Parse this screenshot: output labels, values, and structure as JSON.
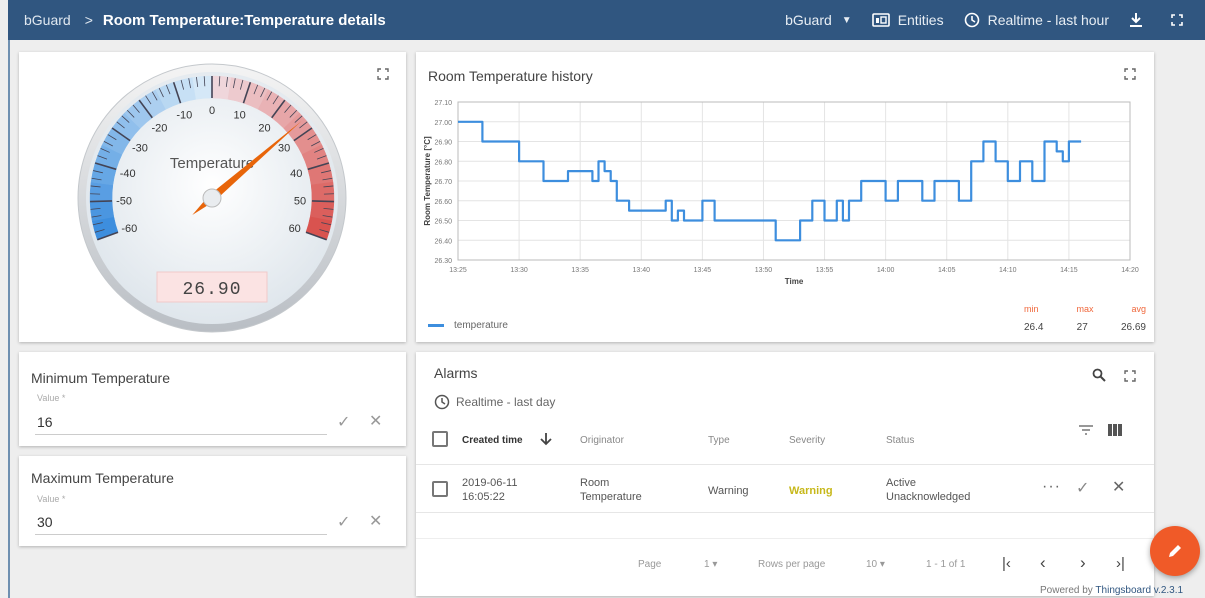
{
  "topbar": {
    "root": "bGuard",
    "separator": ">",
    "title": "Room Temperature:Temperature details",
    "entity_select": "bGuard",
    "entities_label": "Entities",
    "timewindow_label": "Realtime - last hour"
  },
  "gauge": {
    "label": "Temperature",
    "value_display": "26.90",
    "value": 26.9,
    "min": -60,
    "max": 60,
    "ticks": [
      "-60",
      "-50",
      "-40",
      "-30",
      "-20",
      "-10",
      "0",
      "10",
      "20",
      "30",
      "40",
      "50",
      "60"
    ],
    "colors": {
      "cold": "#3d8ede",
      "warm": "#d9534f",
      "needle": "#e8650a"
    }
  },
  "history": {
    "title": "Room Temperature history",
    "legend_label": "temperature",
    "stats": {
      "min_label": "min",
      "max_label": "max",
      "avg_label": "avg",
      "min": "26.4",
      "max": "27",
      "avg": "26.69"
    }
  },
  "chart_data": {
    "type": "line",
    "xlabel": "Time",
    "ylabel": "Room Temperature [°C]",
    "ylim": [
      26.3,
      27.1
    ],
    "xlim": [
      "13:25",
      "14:20"
    ],
    "x_ticks": [
      "13:25",
      "13:30",
      "13:35",
      "13:40",
      "13:45",
      "13:50",
      "13:55",
      "14:00",
      "14:05",
      "14:10",
      "14:15",
      "14:20"
    ],
    "y_ticks": [
      "27.10",
      "27.00",
      "26.90",
      "26.80",
      "26.70",
      "26.60",
      "26.50",
      "26.40",
      "26.30"
    ],
    "series": [
      {
        "name": "temperature",
        "color": "#3d8ede",
        "x": [
          "13:25",
          "13:27",
          "13:27",
          "13:30",
          "13:30",
          "13:32",
          "13:32",
          "13:34",
          "13:34",
          "13:36",
          "13:36",
          "13:36.5",
          "13:36.5",
          "13:37",
          "13:37",
          "13:37.5",
          "13:37.5",
          "13:38",
          "13:38",
          "13:39",
          "13:39",
          "13:42",
          "13:42",
          "13:42.5",
          "13:42.5",
          "13:43",
          "13:43",
          "13:43.5",
          "13:43.5",
          "13:44",
          "13:44",
          "13:45",
          "13:45",
          "13:46",
          "13:46",
          "13:47",
          "13:47",
          "13:51",
          "13:51",
          "13:53",
          "13:53",
          "13:54",
          "13:54",
          "13:55",
          "13:55",
          "13:56",
          "13:56",
          "13:56.5",
          "13:56.5",
          "13:57",
          "13:57",
          "13:58",
          "13:58",
          "14:00",
          "14:00",
          "14:01",
          "14:01",
          "14:03",
          "14:03",
          "14:04",
          "14:04",
          "14:05",
          "14:05",
          "14:06",
          "14:06",
          "14:07",
          "14:07",
          "14:08",
          "14:08",
          "14:09",
          "14:09",
          "14:10",
          "14:10",
          "14:11",
          "14:11",
          "14:12",
          "14:12",
          "14:13",
          "14:13",
          "14:14",
          "14:14",
          "14:14.5",
          "14:14.5",
          "14:15",
          "14:15",
          "14:16"
        ],
        "values": [
          27.0,
          27.0,
          26.9,
          26.9,
          26.8,
          26.8,
          26.7,
          26.7,
          26.75,
          26.75,
          26.7,
          26.7,
          26.8,
          26.8,
          26.75,
          26.75,
          26.7,
          26.7,
          26.6,
          26.6,
          26.55,
          26.55,
          26.6,
          26.6,
          26.5,
          26.5,
          26.55,
          26.55,
          26.5,
          26.5,
          26.5,
          26.5,
          26.6,
          26.6,
          26.5,
          26.5,
          26.5,
          26.5,
          26.4,
          26.4,
          26.5,
          26.5,
          26.6,
          26.6,
          26.5,
          26.5,
          26.6,
          26.6,
          26.5,
          26.5,
          26.6,
          26.6,
          26.7,
          26.7,
          26.6,
          26.6,
          26.7,
          26.7,
          26.6,
          26.6,
          26.7,
          26.7,
          26.7,
          26.7,
          26.6,
          26.6,
          26.8,
          26.8,
          26.9,
          26.9,
          26.8,
          26.8,
          26.7,
          26.7,
          26.8,
          26.8,
          26.7,
          26.7,
          26.9,
          26.9,
          26.85,
          26.85,
          26.8,
          26.8,
          26.9,
          26.9
        ]
      }
    ]
  },
  "min_temp": {
    "title": "Minimum Temperature",
    "field_label": "Value *",
    "value": "16"
  },
  "max_temp": {
    "title": "Maximum Temperature",
    "field_label": "Value *",
    "value": "30"
  },
  "alarms": {
    "title": "Alarms",
    "timewindow": "Realtime - last day",
    "columns": [
      "Created time",
      "Originator",
      "Type",
      "Severity",
      "Status"
    ],
    "rows": [
      {
        "created": "2019-06-11 16:05:22",
        "originator": "Room Temperature",
        "type": "Warning",
        "severity": "Warning",
        "status": "Active Unacknowledged"
      }
    ],
    "pager": {
      "page_label": "Page",
      "page": "1",
      "rows_label": "Rows per page",
      "rows": "10",
      "range": "1 - 1 of 1"
    },
    "severity_color": "#c7b81a"
  },
  "footer": {
    "powered_prefix": "Powered by",
    "powered_brand": "Thingsboard v.2.3.1"
  }
}
